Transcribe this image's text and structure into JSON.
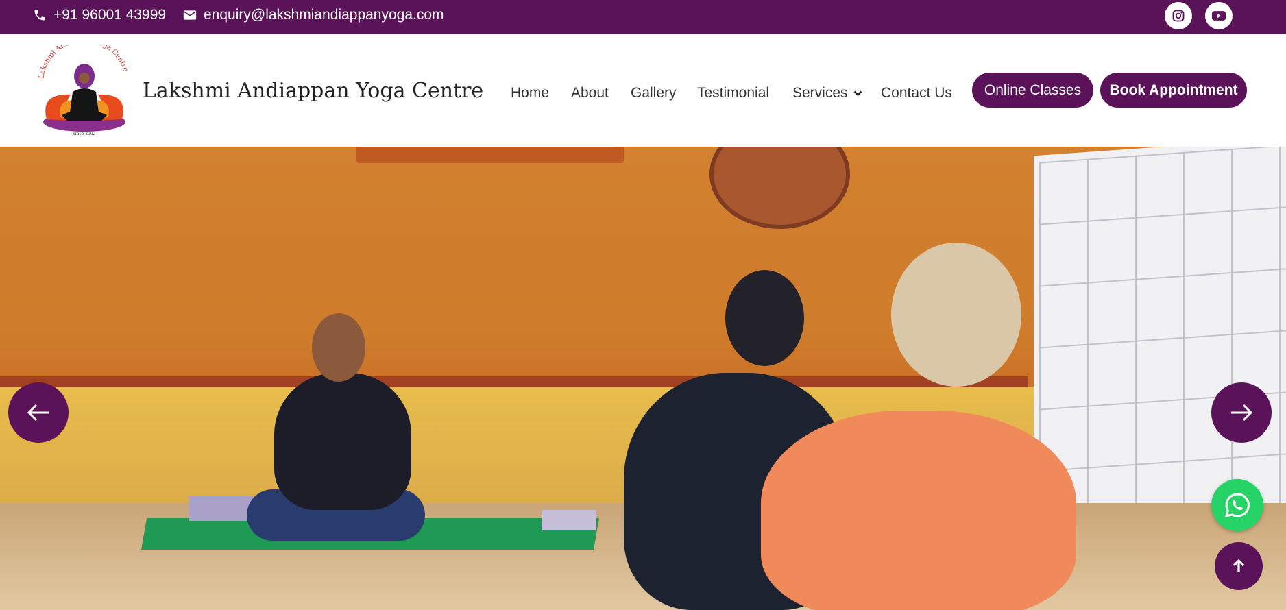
{
  "topbar": {
    "phone": "+91 96001 43999",
    "email": "enquiry@lakshmiandiappanyoga.com",
    "social": [
      "instagram-icon",
      "youtube-icon"
    ]
  },
  "header": {
    "logo_text": "Lakshmi Andiappan Yoga Centre",
    "logo_since": "since 2002",
    "brand": "Lakshmi Andiappan Yoga Centre",
    "nav": {
      "home": "Home",
      "about": "About",
      "gallery": "Gallery",
      "testimonial": "Testimonial",
      "services": "Services",
      "contact": "Contact Us"
    },
    "buttons": {
      "online": "Online Classes",
      "book": "Book Appointment"
    }
  },
  "colors": {
    "brand": "#5a1259",
    "whatsapp": "#25d366",
    "white": "#ffffff"
  },
  "hero": {
    "icons": [
      "arrow-left-icon",
      "arrow-right-icon",
      "whatsapp-icon",
      "arrow-up-icon"
    ]
  }
}
